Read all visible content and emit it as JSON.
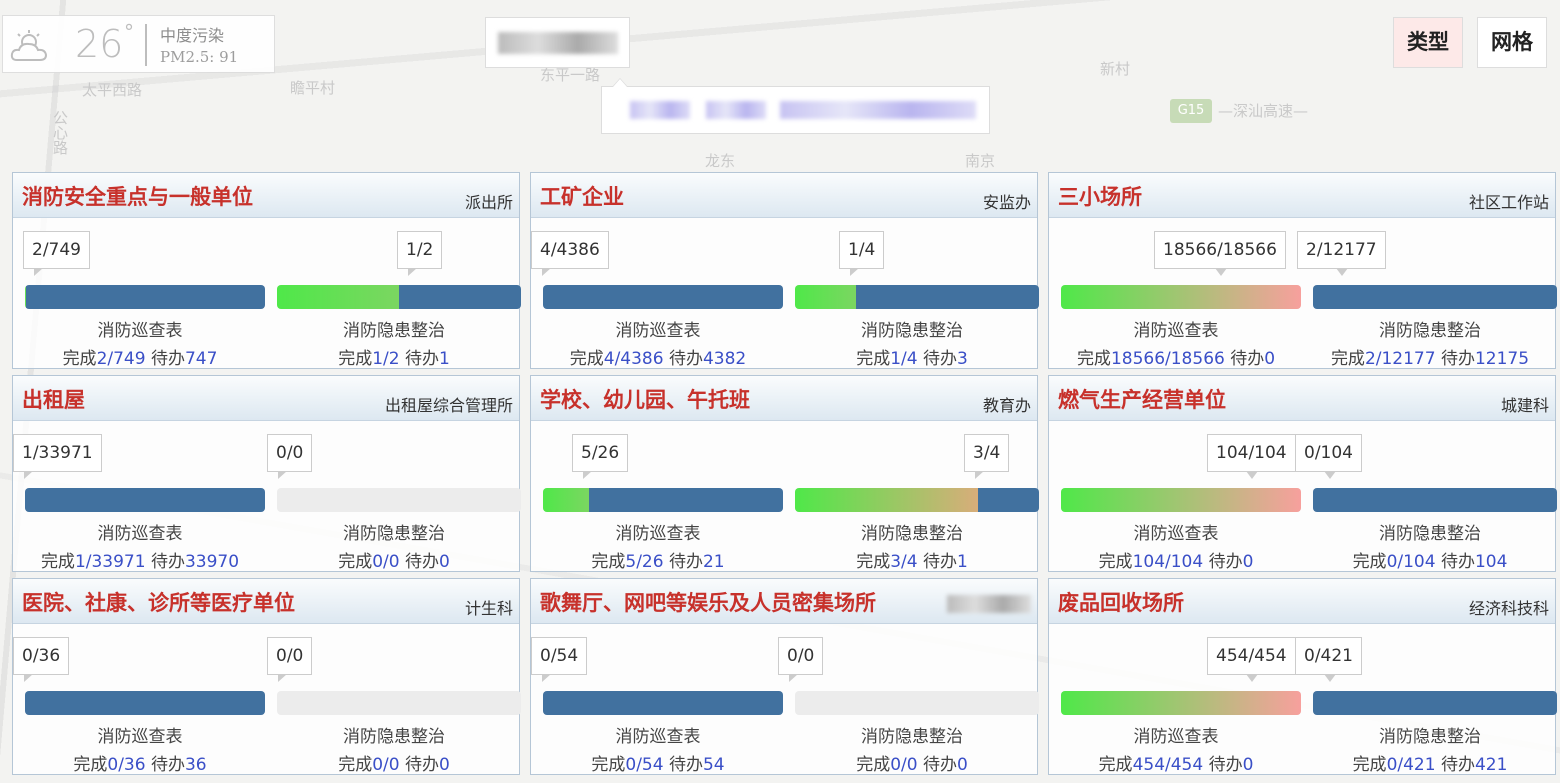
{
  "weather": {
    "icon": "cloud-sun-icon",
    "temperature": "26",
    "degree_symbol": "°",
    "air_quality": "中度污染",
    "pm25": "PM2.5: 91"
  },
  "map_labels": [
    "太平西路",
    "瞻平村",
    "东平一路",
    "龙东",
    "新村",
    "南京",
    "—深汕高速—",
    "G15",
    "公心路"
  ],
  "mode_buttons": {
    "type_label": "类型",
    "grid_label": "网格"
  },
  "stat_words": {
    "done": "完成",
    "todo": "待办"
  },
  "cards": [
    {
      "title": "消防安全重点与一般单位",
      "dept": "派出所",
      "m1": {
        "tag": "2/749",
        "label": "消防巡查表",
        "done": "2/749",
        "todo": "747",
        "progress": 0.003
      },
      "m2": {
        "tag": "1/2",
        "label": "消防隐患整治",
        "done": "1/2",
        "todo": "1",
        "progress": 0.5
      }
    },
    {
      "title": "工矿企业",
      "dept": "安监办",
      "m1": {
        "tag": "4/4386",
        "label": "消防巡查表",
        "done": "4/4386",
        "todo": "4382",
        "progress": 0.001
      },
      "m2": {
        "tag": "1/4",
        "label": "消防隐患整治",
        "done": "1/4",
        "todo": "3",
        "progress": 0.25
      }
    },
    {
      "title": "三小场所",
      "dept": "社区工作站",
      "m1": {
        "tag": "18566/18566",
        "label": "消防巡查表",
        "done": "18566/18566",
        "todo": "0",
        "progress": 1.0
      },
      "m2": {
        "tag": "2/12177",
        "label": "消防隐患整治",
        "done": "2/12177",
        "todo": "12175",
        "progress": 0.0002
      }
    },
    {
      "title": "出租屋",
      "dept": "出租屋综合管理所",
      "m1": {
        "tag": "1/33971",
        "label": "消防巡查表",
        "done": "1/33971",
        "todo": "33970",
        "progress": 3e-05
      },
      "m2": {
        "tag": "0/0",
        "label": "消防隐患整治",
        "done": "0/0",
        "todo": "0",
        "progress": 0
      }
    },
    {
      "title": "学校、幼儿园、午托班",
      "dept": "教育办",
      "m1": {
        "tag": "5/26",
        "label": "消防巡查表",
        "done": "5/26",
        "todo": "21",
        "progress": 0.19
      },
      "m2": {
        "tag": "3/4",
        "label": "消防隐患整治",
        "done": "3/4",
        "todo": "1",
        "progress": 0.75
      }
    },
    {
      "title": "燃气生产经营单位",
      "dept": "城建科",
      "m1": {
        "tag": "104/104",
        "label": "消防巡查表",
        "done": "104/104",
        "todo": "0",
        "progress": 1.0
      },
      "m2": {
        "tag": "0/104",
        "label": "消防隐患整治",
        "done": "0/104",
        "todo": "104",
        "progress": 0
      }
    },
    {
      "title": "医院、社康、诊所等医疗单位",
      "dept": "计生科",
      "m1": {
        "tag": "0/36",
        "label": "消防巡查表",
        "done": "0/36",
        "todo": "36",
        "progress": 0
      },
      "m2": {
        "tag": "0/0",
        "label": "消防隐患整治",
        "done": "0/0",
        "todo": "0",
        "progress": 0
      }
    },
    {
      "title": "歌舞厅、网吧等娱乐及人员密集场所",
      "dept": "",
      "m1": {
        "tag": "0/54",
        "label": "消防巡查表",
        "done": "0/54",
        "todo": "54",
        "progress": 0
      },
      "m2": {
        "tag": "0/0",
        "label": "消防隐患整治",
        "done": "0/0",
        "todo": "0",
        "progress": 0
      }
    },
    {
      "title": "废品回收场所",
      "dept": "经济科技科",
      "m1": {
        "tag": "454/454",
        "label": "消防巡查表",
        "done": "454/454",
        "todo": "0",
        "progress": 1.0
      },
      "m2": {
        "tag": "0/421",
        "label": "消防隐患整治",
        "done": "0/421",
        "todo": "421",
        "progress": 0
      }
    }
  ]
}
